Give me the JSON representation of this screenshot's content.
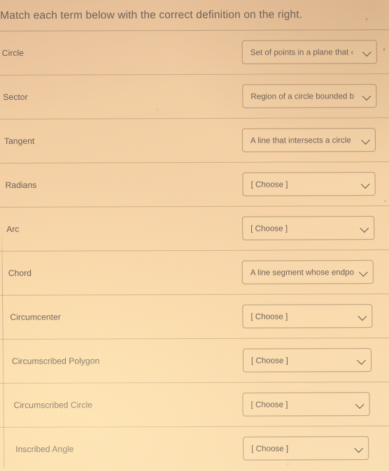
{
  "instructions": "Match each term below with the correct definition on the right.",
  "choose_placeholder": "[ Choose ]",
  "colors": {
    "background": "#f5cfa3",
    "text": "#6d6157",
    "separator": "#7a604a",
    "select_border": "#846a50"
  },
  "rows": [
    {
      "term": "Circle",
      "selected": "Set of points in a plane that ‹"
    },
    {
      "term": "Sector",
      "selected": "Region of a circle bounded b"
    },
    {
      "term": "Tangent",
      "selected": "A line that intersects a circle"
    },
    {
      "term": "Radians",
      "selected": "[ Choose ]"
    },
    {
      "term": "Arc",
      "selected": "[ Choose ]"
    },
    {
      "term": "Chord",
      "selected": "A line segment whose endpo"
    },
    {
      "term": "Circumcenter",
      "selected": "[ Choose ]"
    },
    {
      "term": "Circumscribed Polygon",
      "selected": "[ Choose ]"
    },
    {
      "term": "Circumscribed Circle",
      "selected": "[ Choose ]"
    },
    {
      "term": "Inscribed Angle",
      "selected": "[ Choose ]"
    }
  ],
  "icons": {
    "dropdown": "chevron-down-icon"
  }
}
